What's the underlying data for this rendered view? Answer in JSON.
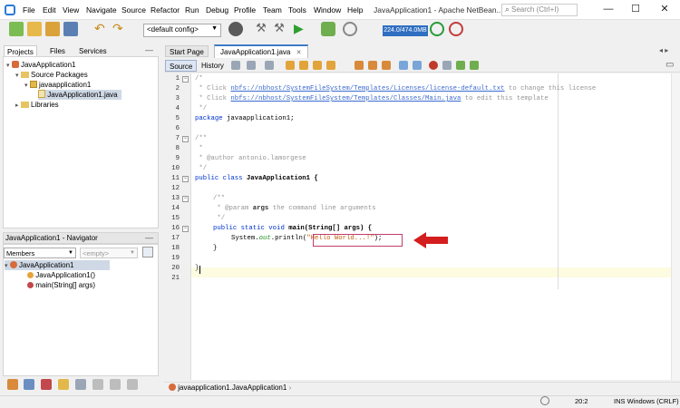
{
  "window": {
    "title": "JavaApplication1 - Apache NetBean...",
    "search_placeholder": "Search (Ctrl+I)",
    "minimize": "—",
    "maximize": "☐",
    "close": "✕"
  },
  "menu": [
    "File",
    "Edit",
    "View",
    "Navigate",
    "Source",
    "Refactor",
    "Run",
    "Debug",
    "Profile",
    "Team",
    "Tools",
    "Window",
    "Help"
  ],
  "toolbar": {
    "config": "<default config>",
    "memory": "224.0/474.0MB"
  },
  "left_tabs": [
    "Projects",
    "Files",
    "Services"
  ],
  "project_tree": [
    {
      "label": "JavaApplication1",
      "icon": "project-icon"
    },
    {
      "label": "Source Packages",
      "icon": "package-folder-icon"
    },
    {
      "label": "javaapplication1",
      "icon": "package-icon"
    },
    {
      "label": "JavaApplication1.java",
      "icon": "java-file-icon"
    },
    {
      "label": "Libraries",
      "icon": "libraries-icon"
    }
  ],
  "navigator": {
    "title": "JavaApplication1 - Navigator",
    "members": "Members",
    "empty": "<empty>",
    "items": [
      {
        "label": "JavaApplication1",
        "icon": "class-icon"
      },
      {
        "label": "JavaApplication1()",
        "icon": "constructor-icon"
      },
      {
        "label": "main(String[] args)",
        "icon": "method-icon"
      }
    ]
  },
  "editor_tabs": [
    "Start Page",
    "JavaApplication1.java"
  ],
  "editor_modes": [
    "Source",
    "History"
  ],
  "line_numbers": [
    "1",
    "2",
    "3",
    "4",
    "5",
    "6",
    "7",
    "8",
    "9",
    "10",
    "11",
    "12",
    "13",
    "14",
    "15",
    "16",
    "17",
    "18",
    "19",
    "20",
    "21"
  ],
  "code": {
    "l1": "/*",
    "l2_a": " * Click ",
    "l2_link": "nbfs://nbhost/SystemFileSystem/Templates/Licenses/license-default.txt",
    "l2_b": " to change this license",
    "l3_a": " * Click ",
    "l3_link": "nbfs://nbhost/SystemFileSystem/Templates/Classes/Main.java",
    "l3_b": " to edit this template",
    "l4": " */",
    "l5_kw": "package",
    "l5_rest": " javaapplication1;",
    "l7": "/**",
    "l8": " *",
    "l9": " * @author antonio.lamorgese",
    "l10": " */",
    "l11_kw": "public class",
    "l11_rest": " JavaApplication1 {",
    "l13": "/**",
    "l14_a": " * @param ",
    "l14_b": "args",
    "l14_c": " the command line arguments",
    "l15": " */",
    "l16_kw": "public static void",
    "l16_rest": " main(String[] args) {",
    "l17_a": "System.",
    "l17_out": "out",
    "l17_b": ".println(",
    "l17_str": "\"Hello World...!\"",
    "l17_c": ");",
    "l18": "}",
    "l20": "}"
  },
  "breadcrumb": "javaapplication1.JavaApplication1",
  "status": {
    "position": "20:2",
    "mode": "INS Windows (CRLF)"
  }
}
